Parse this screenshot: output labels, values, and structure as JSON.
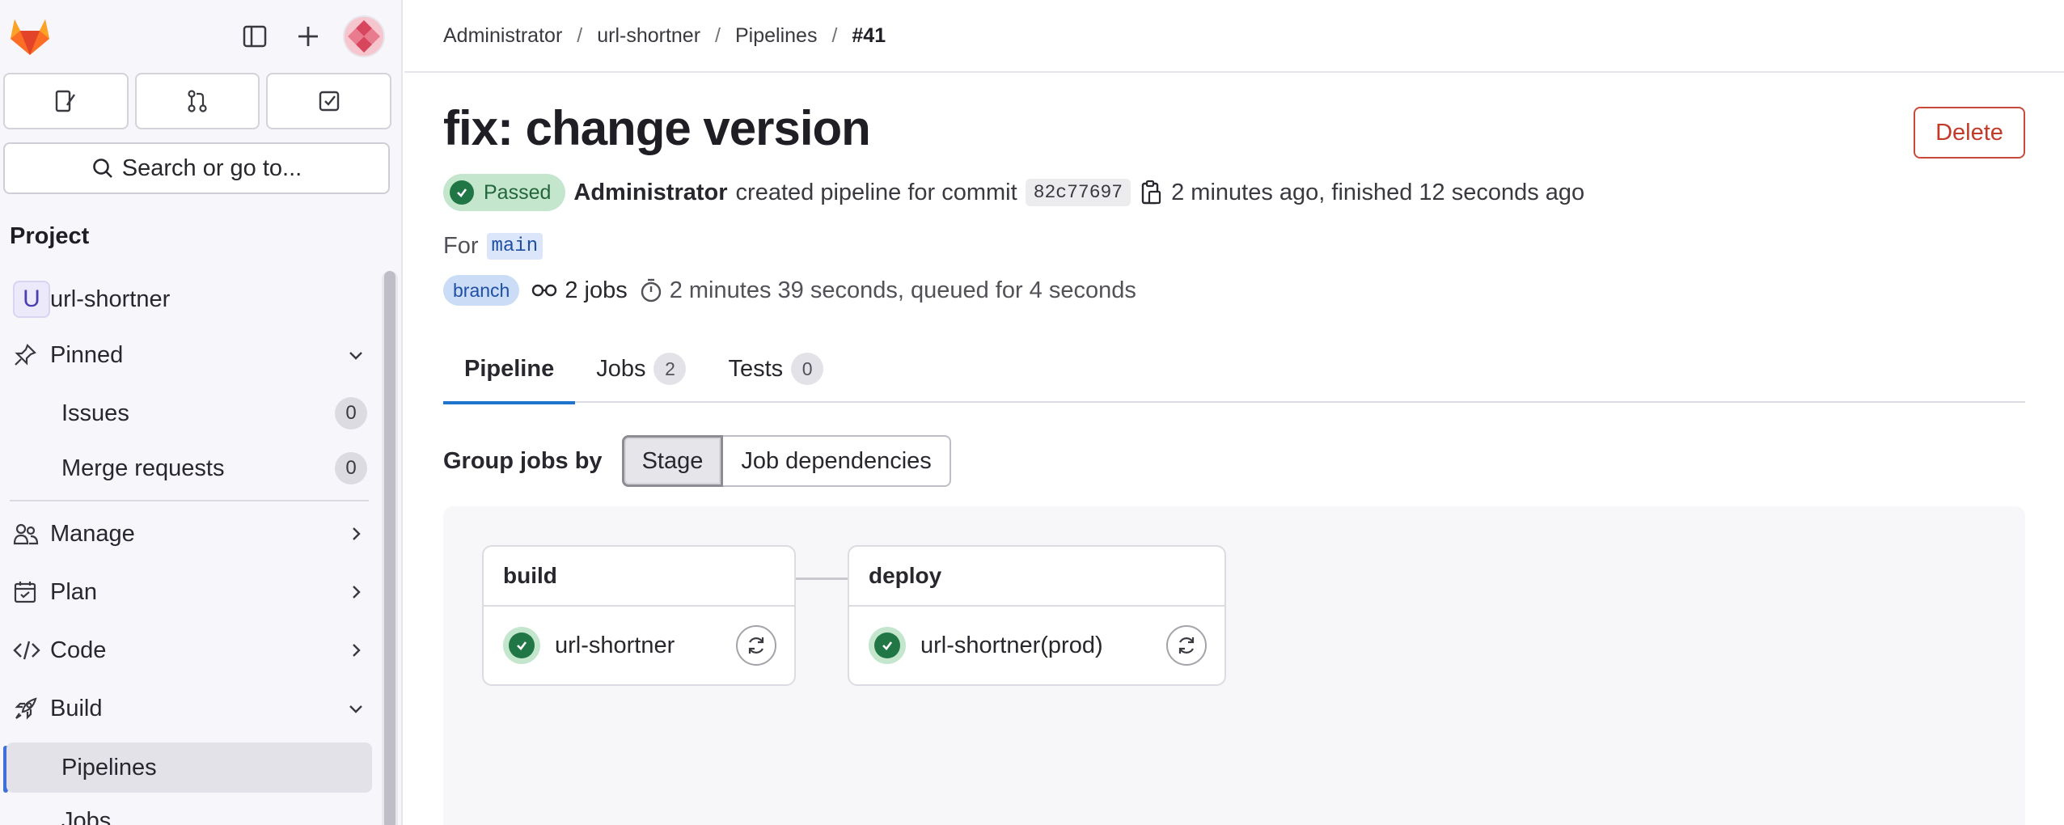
{
  "sidebar": {
    "search_label": "Search or go to...",
    "section_title": "Project",
    "project": {
      "initial": "U",
      "name": "url-shortner"
    },
    "pinned": {
      "label": "Pinned",
      "items": [
        {
          "label": "Issues",
          "count": "0"
        },
        {
          "label": "Merge requests",
          "count": "0"
        }
      ]
    },
    "nav": [
      {
        "label": "Manage",
        "icon": "users-icon"
      },
      {
        "label": "Plan",
        "icon": "calendar-icon"
      },
      {
        "label": "Code",
        "icon": "code-icon"
      },
      {
        "label": "Build",
        "icon": "rocket-icon"
      }
    ],
    "build_items": [
      {
        "label": "Pipelines",
        "active": true
      },
      {
        "label": "Jobs"
      }
    ]
  },
  "breadcrumb": {
    "items": [
      "Administrator",
      "url-shortner",
      "Pipelines"
    ],
    "current": "#41",
    "separator": "/"
  },
  "pipeline": {
    "title": "fix: change version",
    "delete_label": "Delete",
    "status": "Passed",
    "author": "Administrator",
    "created_text": "created pipeline for commit",
    "commit_sha": "82c77697",
    "time_text": "2 minutes ago, finished 12 seconds ago",
    "for_label": "For",
    "ref": "main",
    "ref_type": "branch",
    "jobs_text": "2 jobs",
    "duration_text": "2 minutes 39 seconds, queued for 4 seconds"
  },
  "tabs": [
    {
      "label": "Pipeline",
      "active": true
    },
    {
      "label": "Jobs",
      "count": "2"
    },
    {
      "label": "Tests",
      "count": "0"
    }
  ],
  "group_by": {
    "label": "Group jobs by",
    "options": [
      "Stage",
      "Job dependencies"
    ],
    "selected": "Stage"
  },
  "stages": [
    {
      "name": "build",
      "jobs": [
        {
          "name": "url-shortner",
          "status": "passed"
        }
      ]
    },
    {
      "name": "deploy",
      "jobs": [
        {
          "name": "url-shortner(prod)",
          "status": "passed"
        }
      ]
    }
  ],
  "colors": {
    "success": "#217645",
    "danger": "#c23b29",
    "accent": "#1f75cb"
  }
}
